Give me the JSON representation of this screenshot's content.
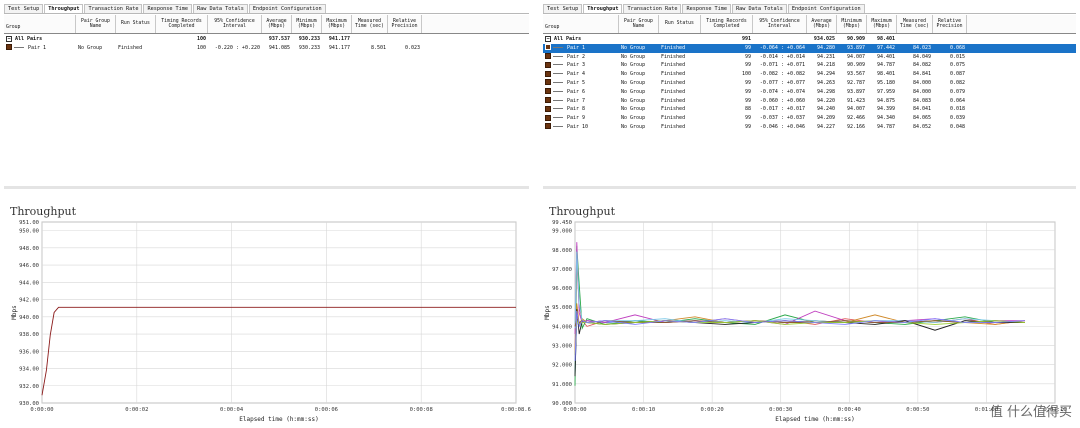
{
  "left": {
    "tabs": [
      {
        "label": "Test Setup",
        "active": false
      },
      {
        "label": "Throughput",
        "active": true
      },
      {
        "label": "Transaction Rate",
        "active": false
      },
      {
        "label": "Response Time",
        "active": false
      },
      {
        "label": "Raw Data Totals",
        "active": false
      },
      {
        "label": "Endpoint Configuration",
        "active": false
      }
    ],
    "columns": [
      {
        "key": "group",
        "label": "Group"
      },
      {
        "key": "pgn",
        "label": "Pair Group\nName"
      },
      {
        "key": "status",
        "label": "Run Status"
      },
      {
        "key": "timing",
        "label": "Timing Records\nCompleted"
      },
      {
        "key": "conf",
        "label": "95% Confidence\nInterval"
      },
      {
        "key": "avg",
        "label": "Average\n(Mbps)"
      },
      {
        "key": "min",
        "label": "Minimum\n(Mbps)"
      },
      {
        "key": "max",
        "label": "Maximum\n(Mbps)"
      },
      {
        "key": "time",
        "label": "Measured\nTime (sec)"
      },
      {
        "key": "prec",
        "label": "Relative\nPrecision"
      }
    ],
    "total_row": {
      "label": "All Pairs",
      "timing": "100",
      "avg": "937.537",
      "min": "930.233",
      "max": "941.177"
    },
    "rows": [
      {
        "pair": "Pair 1",
        "pgn": "No Group",
        "status": "Finished",
        "timing": "100",
        "conf": "-0.220 : +0.220",
        "avg": "941.085",
        "min": "930.233",
        "max": "941.177",
        "time": "8.501",
        "prec": "0.023"
      }
    ],
    "chart": {
      "title": "Throughput"
    },
    "chart_data": {
      "type": "line",
      "title": "Throughput",
      "xlabel": "Elapsed time (h:mm:ss)",
      "ylabel": "Mbps",
      "ylim": [
        930.0,
        951.0
      ],
      "y_ticks": [
        "930.00",
        "932.00",
        "934.00",
        "936.00",
        "938.00",
        "940.00",
        "942.00",
        "944.00",
        "946.00",
        "948.00",
        "950.00",
        "951.00"
      ],
      "x_ticks": [
        "0:00:00",
        "0:00:02",
        "0:00:04",
        "0:00:06",
        "0:00:08",
        "0:00:08.6"
      ],
      "grid": true,
      "series": [
        {
          "name": "Pair 1",
          "color": "#8b1a1a",
          "x": [
            0,
            0.08,
            0.15,
            0.22,
            0.3,
            8.6
          ],
          "values": [
            930.9,
            933.8,
            937.9,
            940.5,
            941.1,
            941.1
          ]
        }
      ]
    }
  },
  "right": {
    "tabs": [
      {
        "label": "Test Setup",
        "active": false
      },
      {
        "label": "Throughput",
        "active": true
      },
      {
        "label": "Transaction Rate",
        "active": false
      },
      {
        "label": "Response Time",
        "active": false
      },
      {
        "label": "Raw Data Totals",
        "active": false
      },
      {
        "label": "Endpoint Configuration",
        "active": false
      }
    ],
    "columns": [
      {
        "key": "group",
        "label": "Group"
      },
      {
        "key": "pgn",
        "label": "Pair Group\nName"
      },
      {
        "key": "status",
        "label": "Run Status"
      },
      {
        "key": "timing",
        "label": "Timing Records\nCompleted"
      },
      {
        "key": "conf",
        "label": "95% Confidence\nInterval"
      },
      {
        "key": "avg",
        "label": "Average\n(Mbps)"
      },
      {
        "key": "min",
        "label": "Minimum\n(Mbps)"
      },
      {
        "key": "max",
        "label": "Maximum\n(Mbps)"
      },
      {
        "key": "time",
        "label": "Measured\nTime (sec)"
      },
      {
        "key": "prec",
        "label": "Relative\nPrecision"
      }
    ],
    "total_row": {
      "label": "All Pairs",
      "timing": "991",
      "avg": "934.025",
      "min": "90.909",
      "max": "98.401"
    },
    "rows": [
      {
        "pair": "Pair 1",
        "pgn": "No Group",
        "status": "Finished",
        "timing": "99",
        "conf": "-0.064 : +0.064",
        "avg": "94.280",
        "min": "93.897",
        "max": "97.442",
        "time": "84.023",
        "prec": "0.068"
      },
      {
        "pair": "Pair 2",
        "pgn": "No Group",
        "status": "Finished",
        "timing": "99",
        "conf": "-0.014 : +0.014",
        "avg": "94.231",
        "min": "94.007",
        "max": "94.401",
        "time": "84.049",
        "prec": "0.015"
      },
      {
        "pair": "Pair 3",
        "pgn": "No Group",
        "status": "Finished",
        "timing": "99",
        "conf": "-0.071 : +0.071",
        "avg": "94.218",
        "min": "90.909",
        "max": "94.787",
        "time": "84.082",
        "prec": "0.075"
      },
      {
        "pair": "Pair 4",
        "pgn": "No Group",
        "status": "Finished",
        "timing": "100",
        "conf": "-0.082 : +0.082",
        "avg": "94.294",
        "min": "93.567",
        "max": "98.401",
        "time": "84.841",
        "prec": "0.087"
      },
      {
        "pair": "Pair 5",
        "pgn": "No Group",
        "status": "Finished",
        "timing": "99",
        "conf": "-0.077 : +0.077",
        "avg": "94.263",
        "min": "92.787",
        "max": "95.180",
        "time": "84.000",
        "prec": "0.082"
      },
      {
        "pair": "Pair 6",
        "pgn": "No Group",
        "status": "Finished",
        "timing": "99",
        "conf": "-0.074 : +0.074",
        "avg": "94.298",
        "min": "93.897",
        "max": "97.959",
        "time": "84.000",
        "prec": "0.079"
      },
      {
        "pair": "Pair 7",
        "pgn": "No Group",
        "status": "Finished",
        "timing": "99",
        "conf": "-0.060 : +0.060",
        "avg": "94.220",
        "min": "91.423",
        "max": "94.875",
        "time": "84.083",
        "prec": "0.064"
      },
      {
        "pair": "Pair 8",
        "pgn": "No Group",
        "status": "Finished",
        "timing": "88",
        "conf": "-0.017 : +0.017",
        "avg": "94.240",
        "min": "94.007",
        "max": "94.399",
        "time": "84.041",
        "prec": "0.018"
      },
      {
        "pair": "Pair 9",
        "pgn": "No Group",
        "status": "Finished",
        "timing": "99",
        "conf": "-0.037 : +0.037",
        "avg": "94.209",
        "min": "92.466",
        "max": "94.340",
        "time": "84.065",
        "prec": "0.039"
      },
      {
        "pair": "Pair 10",
        "pgn": "No Group",
        "status": "Finished",
        "timing": "99",
        "conf": "-0.046 : +0.046",
        "avg": "94.227",
        "min": "92.166",
        "max": "94.787",
        "time": "84.052",
        "prec": "0.048"
      }
    ],
    "chart": {
      "title": "Throughput"
    },
    "chart_data": {
      "type": "line",
      "title": "Throughput",
      "xlabel": "Elapsed time (h:mm:ss)",
      "ylabel": "Mbps",
      "ylim": [
        90.0,
        99.45
      ],
      "y_ticks": [
        "90.000",
        "91.000",
        "92.000",
        "93.000",
        "94.000",
        "95.000",
        "96.000",
        "97.000",
        "98.000",
        "99.000",
        "99.450"
      ],
      "x_ticks": [
        "0:00:00",
        "0:00:10",
        "0:00:20",
        "0:00:30",
        "0:00:40",
        "0:00:50",
        "0:01:00",
        "0:01:10"
      ],
      "grid": true,
      "series": [
        {
          "name": "Pair 1",
          "color": "#e05a5a",
          "x": [
            0,
            0.3,
            0.7,
            1.2,
            2,
            5,
            10,
            15,
            20,
            25,
            30,
            35,
            40,
            45,
            50,
            55,
            60,
            65,
            70,
            75
          ],
          "values": [
            92.5,
            97.4,
            95.0,
            94.3,
            94.0,
            94.3,
            94.2,
            94.3,
            94.2,
            94.4,
            94.2,
            94.3,
            94.1,
            94.4,
            94.2,
            94.3,
            94.2,
            94.4,
            94.1,
            94.3
          ]
        },
        {
          "name": "Pair 2",
          "color": "#3a6fd8",
          "x": [
            0,
            0.3,
            0.7,
            1.2,
            2,
            5,
            10,
            15,
            20,
            25,
            30,
            35,
            40,
            45,
            50,
            55,
            60,
            65,
            70,
            75
          ],
          "values": [
            91.5,
            94.4,
            94.1,
            94.2,
            94.3,
            94.2,
            94.3,
            94.2,
            94.3,
            94.2,
            94.3,
            94.2,
            94.3,
            94.2,
            94.3,
            94.2,
            94.3,
            94.2,
            94.3,
            94.2
          ]
        },
        {
          "name": "Pair 3",
          "color": "#2aa84a",
          "x": [
            0,
            0.3,
            0.7,
            1.2,
            2,
            5,
            10,
            15,
            20,
            25,
            30,
            35,
            40,
            45,
            50,
            55,
            60,
            65,
            70,
            75
          ],
          "values": [
            90.9,
            98.2,
            96.2,
            93.9,
            94.4,
            94.1,
            94.3,
            94.2,
            94.4,
            94.2,
            94.1,
            94.6,
            94.2,
            94.3,
            94.2,
            94.1,
            94.3,
            94.5,
            94.2,
            94.2
          ]
        },
        {
          "name": "Pair 4",
          "color": "#c040c0",
          "x": [
            0,
            0.3,
            0.7,
            1.2,
            2,
            5,
            10,
            15,
            20,
            25,
            30,
            35,
            40,
            45,
            50,
            55,
            60,
            65,
            70,
            75
          ],
          "values": [
            93.6,
            98.4,
            94.7,
            94.2,
            94.3,
            94.2,
            94.6,
            94.2,
            94.3,
            94.2,
            94.3,
            94.1,
            94.8,
            94.3,
            94.2,
            94.3,
            94.4,
            94.2,
            94.3,
            94.3
          ]
        },
        {
          "name": "Pair 5",
          "color": "#d08a2a",
          "x": [
            0,
            0.3,
            0.7,
            1.2,
            2,
            5,
            10,
            15,
            20,
            25,
            30,
            35,
            40,
            45,
            50,
            55,
            60,
            65,
            70,
            75
          ],
          "values": [
            92.8,
            95.2,
            94.1,
            94.4,
            94.2,
            94.3,
            94.2,
            94.3,
            94.5,
            94.2,
            94.3,
            94.2,
            94.3,
            94.2,
            94.6,
            94.2,
            94.3,
            94.2,
            94.1,
            94.3
          ]
        },
        {
          "name": "Pair 6",
          "color": "#7ac8e8",
          "x": [
            0,
            0.3,
            0.7,
            1.2,
            2,
            5,
            10,
            15,
            20,
            25,
            30,
            35,
            40,
            45,
            50,
            55,
            60,
            65,
            70,
            75
          ],
          "values": [
            93.9,
            97.9,
            95.2,
            94.3,
            94.2,
            94.3,
            94.3,
            94.4,
            94.2,
            94.3,
            94.2,
            94.4,
            94.3,
            94.2,
            94.3,
            94.3,
            94.2,
            94.4,
            94.3,
            94.2
          ]
        },
        {
          "name": "Pair 7",
          "color": "#222222",
          "x": [
            0,
            0.3,
            0.7,
            1.2,
            2,
            5,
            10,
            15,
            20,
            25,
            30,
            35,
            40,
            45,
            50,
            55,
            60,
            65,
            70,
            75
          ],
          "values": [
            91.4,
            94.9,
            93.6,
            94.3,
            94.2,
            94.1,
            94.2,
            94.3,
            94.2,
            94.1,
            94.2,
            94.3,
            94.2,
            94.2,
            94.1,
            94.3,
            93.8,
            94.3,
            94.2,
            94.2
          ]
        },
        {
          "name": "Pair 8",
          "color": "#8a5a2a",
          "x": [
            0,
            0.3,
            0.7,
            1.2,
            2,
            5,
            10,
            15,
            20,
            25,
            30,
            35,
            40,
            45,
            50,
            55,
            60,
            65,
            70,
            75
          ],
          "values": [
            94.0,
            94.4,
            94.2,
            94.3,
            94.2,
            94.3,
            94.2,
            94.2,
            94.3,
            94.2,
            94.3,
            94.2,
            94.2,
            94.3,
            94.2,
            94.2,
            94.3,
            94.2,
            94.3,
            94.2
          ]
        },
        {
          "name": "Pair 9",
          "color": "#9acd32",
          "x": [
            0,
            0.3,
            0.7,
            1.2,
            2,
            5,
            10,
            15,
            20,
            25,
            30,
            35,
            40,
            45,
            50,
            55,
            60,
            65,
            70,
            75
          ],
          "values": [
            92.5,
            94.3,
            94.1,
            94.2,
            94.2,
            94.1,
            94.2,
            94.3,
            94.2,
            94.2,
            94.3,
            94.1,
            94.2,
            94.2,
            94.3,
            94.2,
            94.1,
            94.2,
            94.3,
            94.2
          ]
        },
        {
          "name": "Pair 10",
          "color": "#8080ff",
          "x": [
            0,
            0.3,
            0.7,
            1.2,
            2,
            5,
            10,
            15,
            20,
            25,
            30,
            35,
            40,
            45,
            50,
            55,
            60,
            65,
            70,
            75
          ],
          "values": [
            92.2,
            94.8,
            94.0,
            94.3,
            94.2,
            94.3,
            94.1,
            94.3,
            94.2,
            94.4,
            94.2,
            94.3,
            94.2,
            94.1,
            94.3,
            94.2,
            94.4,
            94.2,
            94.2,
            94.3
          ]
        }
      ]
    }
  },
  "watermark": {
    "text": "值 什么值得买"
  }
}
